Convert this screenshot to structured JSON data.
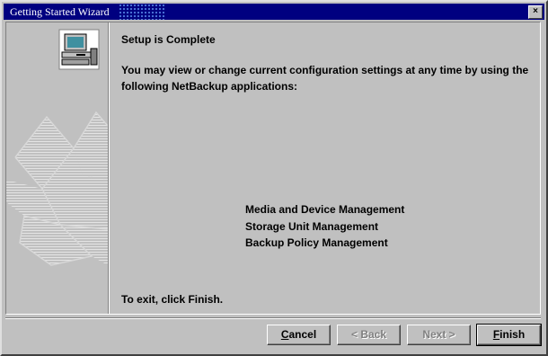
{
  "window": {
    "title": "Getting Started Wizard",
    "close_label": "×"
  },
  "sidebar": {
    "icon": "computer-icon",
    "art": "box-graphic"
  },
  "content": {
    "heading": "Setup is Complete",
    "description": "You may view or change current configuration settings at any time by using the following NetBackup applications:",
    "applications": [
      "Media and Device Management",
      "Storage Unit Management",
      "Backup Policy Management"
    ],
    "exit_text": "To exit, click Finish."
  },
  "buttons": {
    "cancel": {
      "mnemonic": "C",
      "rest": "ancel"
    },
    "back": {
      "label": "< Back"
    },
    "next": {
      "label": "Next >"
    },
    "finish": {
      "mnemonic": "F",
      "rest": "inish"
    }
  },
  "colors": {
    "titlebar": "#000080",
    "face": "#c0c0c0",
    "disabled_text": "#808080"
  }
}
